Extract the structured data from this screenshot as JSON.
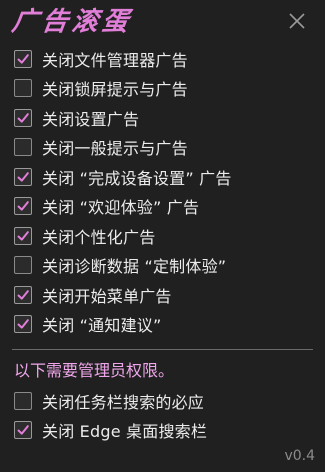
{
  "app": {
    "title": "广告滚蛋",
    "version": "v0.4",
    "accent_color": "#e07ed8",
    "close_icon": "close-icon"
  },
  "options": [
    {
      "label": "关闭文件管理器广告",
      "checked": true
    },
    {
      "label": "关闭锁屏提示与广告",
      "checked": false
    },
    {
      "label": "关闭设置广告",
      "checked": true
    },
    {
      "label": "关闭一般提示与广告",
      "checked": false
    },
    {
      "label": "关闭 “完成设备设置” 广告",
      "checked": true
    },
    {
      "label": "关闭 “欢迎体验” 广告",
      "checked": true
    },
    {
      "label": "关闭个性化广告",
      "checked": true
    },
    {
      "label": "关闭诊断数据 “定制体验”",
      "checked": false
    },
    {
      "label": "关闭开始菜单广告",
      "checked": true
    },
    {
      "label": "关闭 “通知建议”",
      "checked": true
    }
  ],
  "admin_note": "以下需要管理员权限。",
  "admin_options": [
    {
      "label": "关闭任务栏搜索的必应",
      "checked": false
    },
    {
      "label": "关闭 Edge 桌面搜索栏",
      "checked": true
    }
  ]
}
